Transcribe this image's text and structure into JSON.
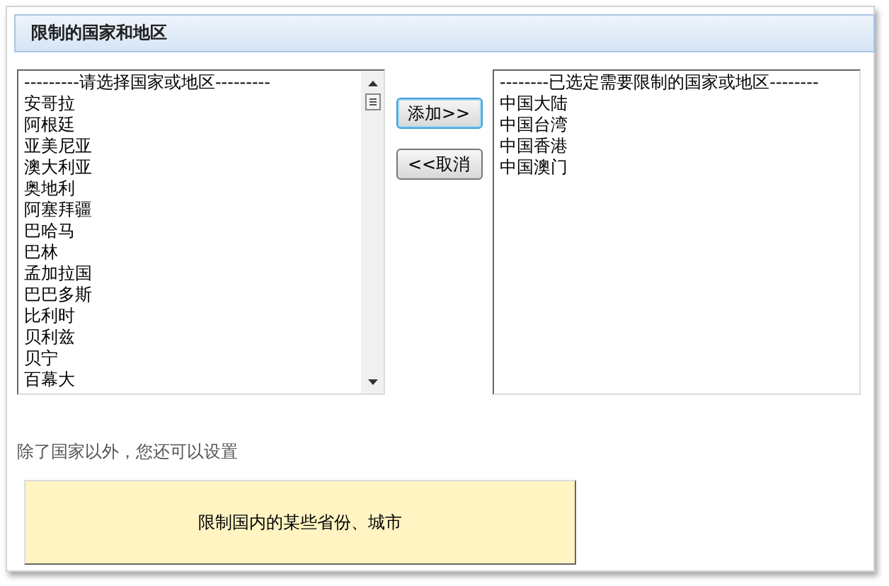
{
  "panel": {
    "title": "限制的国家和地区"
  },
  "available": {
    "header": "---------请选择国家或地区---------",
    "items": [
      "安哥拉",
      "阿根廷",
      "亚美尼亚",
      "澳大利亚",
      "奥地利",
      "阿塞拜疆",
      "巴哈马",
      "巴林",
      "孟加拉国",
      "巴巴多斯",
      "比利时",
      "贝利兹",
      "贝宁",
      "百幕大"
    ]
  },
  "buttons": [
    {
      "label": "添加>>",
      "focused": true
    },
    {
      "label": "<<取消",
      "focused": false
    }
  ],
  "restricted": {
    "header": "--------已选定需要限制的国家或地区--------",
    "items": [
      "中国大陆",
      "中国台湾",
      "中国香港",
      "中国澳门"
    ]
  },
  "hint": "除了国家以外，您还可以设置",
  "province_button": "限制国内的某些省份、城市"
}
